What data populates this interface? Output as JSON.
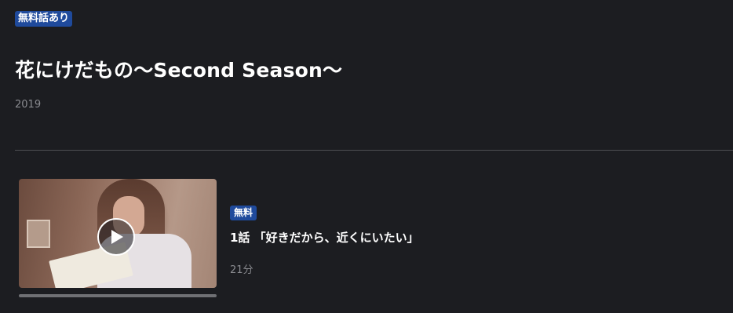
{
  "header": {
    "badge": "無料話あり",
    "title": "花にけだもの〜Second Season〜",
    "year": "2019"
  },
  "episodes": [
    {
      "badge": "無料",
      "title": "1話 「好きだから、近くにいたい」",
      "duration": "21分",
      "thumbnail_icon": "play-icon"
    }
  ],
  "colors": {
    "background": "#1c1d21",
    "badge": "#1f4a9c",
    "muted_text": "#8a8b90",
    "divider": "#4d4e53"
  }
}
